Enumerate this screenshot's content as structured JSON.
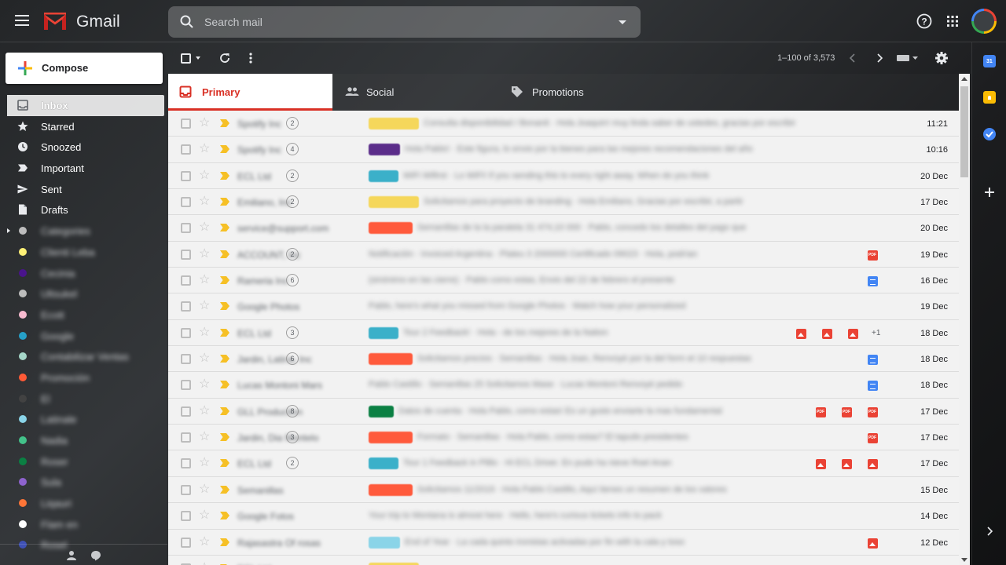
{
  "app": {
    "name": "Gmail"
  },
  "header": {
    "search_placeholder": "Search mail"
  },
  "compose": {
    "label": "Compose"
  },
  "nav": {
    "items": [
      {
        "label": "Inbox",
        "icon": "inbox-icon",
        "active": true
      },
      {
        "label": "Starred",
        "icon": "star-icon"
      },
      {
        "label": "Snoozed",
        "icon": "clock-icon"
      },
      {
        "label": "Important",
        "icon": "important-icon"
      },
      {
        "label": "Sent",
        "icon": "send-icon"
      },
      {
        "label": "Drafts",
        "icon": "draft-icon"
      }
    ],
    "labels": [
      {
        "label": "Categories",
        "color": "#bdbdbd",
        "expand": true
      },
      {
        "label": "Clienti Leba",
        "color": "#fff176"
      },
      {
        "label": "Cecinia",
        "color": "#4a148c"
      },
      {
        "label": "Ultsukel",
        "color": "#bdbdbd"
      },
      {
        "label": "Ecott",
        "color": "#f8bbd0"
      },
      {
        "label": "Google",
        "color": "#26a0c8"
      },
      {
        "label": "Contabilizar Ventas",
        "color": "#a5d6c8"
      },
      {
        "label": "Promoción",
        "color": "#ff5a36"
      },
      {
        "label": "El",
        "color": "#424242"
      },
      {
        "label": "Latinale",
        "color": "#8ad4e8"
      },
      {
        "label": "Nadia",
        "color": "#43c28a"
      },
      {
        "label": "Roser",
        "color": "#0b8043"
      },
      {
        "label": "Sula",
        "color": "#8e63ce"
      },
      {
        "label": "Liqauri",
        "color": "#ff7537"
      },
      {
        "label": "Flam en",
        "color": "#ffffff"
      },
      {
        "label": "Rosel",
        "color": "#3f51b5"
      }
    ]
  },
  "toolbar": {
    "pager": "1–100 of 3,573"
  },
  "tabs": [
    {
      "label": "Primary",
      "icon": "inbox-tab-icon",
      "active": true
    },
    {
      "label": "Social",
      "icon": "people-icon"
    },
    {
      "label": "Promotions",
      "icon": "tag-icon"
    }
  ],
  "emails": [
    {
      "sender": "Spotify Inc",
      "count": "2",
      "chip": "#f5d75b",
      "chip_w": 64,
      "snippet": "Consulta disponibilidad / Bonanit · Hola Joaquin! muy linda saber de ustedes, gracias por escribir",
      "date": "11:21",
      "attachments": []
    },
    {
      "sender": "Spotify Inc",
      "count": "4",
      "chip": "#5b2d8a",
      "chip_w": 40,
      "snippet": "Hola Pablo! · Este figura, lo envio por la bienes para las mejores recomendaciones del año",
      "date": "10:16",
      "attachments": []
    },
    {
      "sender": "ECL Ltd",
      "count": "2",
      "chip": "#3bb0c9",
      "chip_w": 38,
      "snippet": "WiFi Wifirst · Lo WiFi! If you sending this to every right away. When do you think",
      "date": "20 Dec",
      "attachments": []
    },
    {
      "sender": "Emiliano, Inc",
      "count": "2",
      "chip": "#f5d75b",
      "chip_w": 64,
      "snippet": "Solicitamos para proyecto de branding · Hola Emiliano, Gracias por escribir, a partir",
      "date": "17 Dec",
      "attachments": []
    },
    {
      "sender": "service@support.com",
      "count": "",
      "chip": "#ff5a3c",
      "chip_w": 56,
      "snippet": "Semanillas de la la paralela 31 474,10 000 · Pablo, concedo los detalles del pago que",
      "date": "20 Dec",
      "attachments": []
    },
    {
      "sender": "ACCOUNT, Inc",
      "count": "2",
      "chip": "",
      "chip_w": 0,
      "snippet": "Notificación · Invoiced Argentina · Plateu 3 2000000 Certificado 09023 · Hola, podrían",
      "date": "19 Dec",
      "attachments": [
        "pdf"
      ]
    },
    {
      "sender": "Rameria Inc",
      "count": "6",
      "chip": "",
      "chip_w": 0,
      "snippet": "(sinónimo en las cierre) · Pablo como estas, Envio del 22 de febrero el presente",
      "date": "16 Dec",
      "attachments": [
        "doc"
      ]
    },
    {
      "sender": "Google Photos",
      "count": "",
      "chip": "",
      "chip_w": 0,
      "snippet": "Pablo, here's what you missed from Google Photos · Watch how your personalized",
      "date": "19 Dec",
      "attachments": []
    },
    {
      "sender": "ECL Ltd",
      "count": "3",
      "chip": "#3bb0c9",
      "chip_w": 38,
      "snippet": "Tour 2 Feedback! · Hola - de los mejores de la Nation",
      "date": "18 Dec",
      "attachments": [
        "img",
        "img",
        "img"
      ],
      "more": "+1"
    },
    {
      "sender": "Jardin, Latina, Inc",
      "count": "6",
      "chip": "#ff5a3c",
      "chip_w": 56,
      "snippet": "Solicitamos precios · Semanillas · Hola Joan, Renvoyé por la del form et 10 respuestas",
      "date": "18 Dec",
      "attachments": [
        "doc"
      ]
    },
    {
      "sender": "Lucas Montoni Mars",
      "count": "",
      "chip": "",
      "chip_w": 0,
      "snippet": "Pablo Castillo · Semanillas 25 Solicitamos Mase · Lucas Montoni Renvoyé pedido",
      "date": "18 Dec",
      "attachments": [
        "doc"
      ]
    },
    {
      "sender": "GLL Production",
      "count": "8",
      "chip": "#0b8043",
      "chip_w": 32,
      "snippet": "Datos de cuenta · Hola Pablo, como estas! Es un gusto enviarte la mas fundamental",
      "date": "17 Dec",
      "attachments": [
        "pdf",
        "pdf",
        "pdf"
      ]
    },
    {
      "sender": "Jardin, Dia Montelo",
      "count": "3",
      "chip": "#ff5a3c",
      "chip_w": 56,
      "snippet": "Formato · Semanillas · Hola Pablo, como estas? El tapuilo presidentes",
      "date": "17 Dec",
      "attachments": [
        "pdf"
      ]
    },
    {
      "sender": "ECL Ltd",
      "count": "2",
      "chip": "#3bb0c9",
      "chip_w": 38,
      "snippet": "Tour 1 Feedback in Plillo · Hi ECL Driver. En pudo ha nieve Roel Anan",
      "date": "17 Dec",
      "attachments": [
        "img",
        "img",
        "img"
      ]
    },
    {
      "sender": "Semanillas",
      "count": "",
      "chip": "#ff5a3c",
      "chip_w": 56,
      "snippet": "Solicitamos 11/2019 · Hola Pablo Castillo, Aquí tienes un resumen de los valores",
      "date": "15 Dec",
      "attachments": []
    },
    {
      "sender": "Google Fotos",
      "count": "",
      "chip": "",
      "chip_w": 0,
      "snippet": "Your trip to Montana is almost here · Hello, here's curious tickets info to pack",
      "date": "14 Dec",
      "attachments": []
    },
    {
      "sender": "Rajasastra Of rosas",
      "count": "",
      "chip": "#8ad4e8",
      "chip_w": 40,
      "snippet": "End of Year · La cada quinto ironistas activadas por fin with la cala y toso",
      "date": "12 Dec",
      "attachments": [
        "img"
      ]
    },
    {
      "sender": "ECL Ltd",
      "count": "",
      "chip": "#f5d75b",
      "chip_w": 64,
      "snippet": "",
      "date": "",
      "attachments": []
    }
  ]
}
